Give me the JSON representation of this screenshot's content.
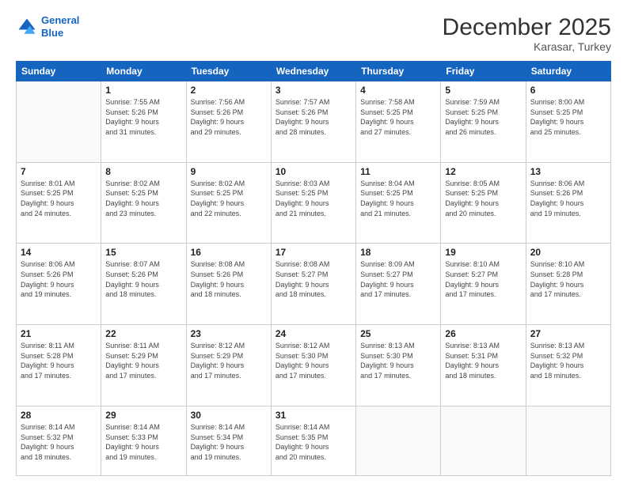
{
  "header": {
    "logo_line1": "General",
    "logo_line2": "Blue",
    "month": "December 2025",
    "location": "Karasar, Turkey"
  },
  "days_of_week": [
    "Sunday",
    "Monday",
    "Tuesday",
    "Wednesday",
    "Thursday",
    "Friday",
    "Saturday"
  ],
  "weeks": [
    [
      {
        "day": "",
        "info": ""
      },
      {
        "day": "1",
        "info": "Sunrise: 7:55 AM\nSunset: 5:26 PM\nDaylight: 9 hours\nand 31 minutes."
      },
      {
        "day": "2",
        "info": "Sunrise: 7:56 AM\nSunset: 5:26 PM\nDaylight: 9 hours\nand 29 minutes."
      },
      {
        "day": "3",
        "info": "Sunrise: 7:57 AM\nSunset: 5:26 PM\nDaylight: 9 hours\nand 28 minutes."
      },
      {
        "day": "4",
        "info": "Sunrise: 7:58 AM\nSunset: 5:25 PM\nDaylight: 9 hours\nand 27 minutes."
      },
      {
        "day": "5",
        "info": "Sunrise: 7:59 AM\nSunset: 5:25 PM\nDaylight: 9 hours\nand 26 minutes."
      },
      {
        "day": "6",
        "info": "Sunrise: 8:00 AM\nSunset: 5:25 PM\nDaylight: 9 hours\nand 25 minutes."
      }
    ],
    [
      {
        "day": "7",
        "info": "Sunrise: 8:01 AM\nSunset: 5:25 PM\nDaylight: 9 hours\nand 24 minutes."
      },
      {
        "day": "8",
        "info": "Sunrise: 8:02 AM\nSunset: 5:25 PM\nDaylight: 9 hours\nand 23 minutes."
      },
      {
        "day": "9",
        "info": "Sunrise: 8:02 AM\nSunset: 5:25 PM\nDaylight: 9 hours\nand 22 minutes."
      },
      {
        "day": "10",
        "info": "Sunrise: 8:03 AM\nSunset: 5:25 PM\nDaylight: 9 hours\nand 21 minutes."
      },
      {
        "day": "11",
        "info": "Sunrise: 8:04 AM\nSunset: 5:25 PM\nDaylight: 9 hours\nand 21 minutes."
      },
      {
        "day": "12",
        "info": "Sunrise: 8:05 AM\nSunset: 5:25 PM\nDaylight: 9 hours\nand 20 minutes."
      },
      {
        "day": "13",
        "info": "Sunrise: 8:06 AM\nSunset: 5:26 PM\nDaylight: 9 hours\nand 19 minutes."
      }
    ],
    [
      {
        "day": "14",
        "info": "Sunrise: 8:06 AM\nSunset: 5:26 PM\nDaylight: 9 hours\nand 19 minutes."
      },
      {
        "day": "15",
        "info": "Sunrise: 8:07 AM\nSunset: 5:26 PM\nDaylight: 9 hours\nand 18 minutes."
      },
      {
        "day": "16",
        "info": "Sunrise: 8:08 AM\nSunset: 5:26 PM\nDaylight: 9 hours\nand 18 minutes."
      },
      {
        "day": "17",
        "info": "Sunrise: 8:08 AM\nSunset: 5:27 PM\nDaylight: 9 hours\nand 18 minutes."
      },
      {
        "day": "18",
        "info": "Sunrise: 8:09 AM\nSunset: 5:27 PM\nDaylight: 9 hours\nand 17 minutes."
      },
      {
        "day": "19",
        "info": "Sunrise: 8:10 AM\nSunset: 5:27 PM\nDaylight: 9 hours\nand 17 minutes."
      },
      {
        "day": "20",
        "info": "Sunrise: 8:10 AM\nSunset: 5:28 PM\nDaylight: 9 hours\nand 17 minutes."
      }
    ],
    [
      {
        "day": "21",
        "info": "Sunrise: 8:11 AM\nSunset: 5:28 PM\nDaylight: 9 hours\nand 17 minutes."
      },
      {
        "day": "22",
        "info": "Sunrise: 8:11 AM\nSunset: 5:29 PM\nDaylight: 9 hours\nand 17 minutes."
      },
      {
        "day": "23",
        "info": "Sunrise: 8:12 AM\nSunset: 5:29 PM\nDaylight: 9 hours\nand 17 minutes."
      },
      {
        "day": "24",
        "info": "Sunrise: 8:12 AM\nSunset: 5:30 PM\nDaylight: 9 hours\nand 17 minutes."
      },
      {
        "day": "25",
        "info": "Sunrise: 8:13 AM\nSunset: 5:30 PM\nDaylight: 9 hours\nand 17 minutes."
      },
      {
        "day": "26",
        "info": "Sunrise: 8:13 AM\nSunset: 5:31 PM\nDaylight: 9 hours\nand 18 minutes."
      },
      {
        "day": "27",
        "info": "Sunrise: 8:13 AM\nSunset: 5:32 PM\nDaylight: 9 hours\nand 18 minutes."
      }
    ],
    [
      {
        "day": "28",
        "info": "Sunrise: 8:14 AM\nSunset: 5:32 PM\nDaylight: 9 hours\nand 18 minutes."
      },
      {
        "day": "29",
        "info": "Sunrise: 8:14 AM\nSunset: 5:33 PM\nDaylight: 9 hours\nand 19 minutes."
      },
      {
        "day": "30",
        "info": "Sunrise: 8:14 AM\nSunset: 5:34 PM\nDaylight: 9 hours\nand 19 minutes."
      },
      {
        "day": "31",
        "info": "Sunrise: 8:14 AM\nSunset: 5:35 PM\nDaylight: 9 hours\nand 20 minutes."
      },
      {
        "day": "",
        "info": ""
      },
      {
        "day": "",
        "info": ""
      },
      {
        "day": "",
        "info": ""
      }
    ]
  ]
}
